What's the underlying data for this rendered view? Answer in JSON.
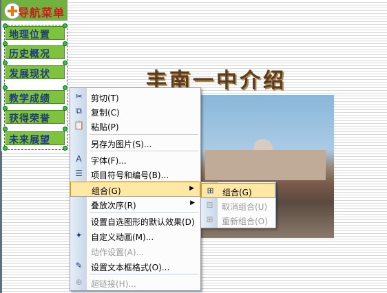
{
  "slide": {
    "heading": "丰南一中介绍",
    "nav": {
      "title": "导航菜单",
      "buttons": [
        "地理位置",
        "历史概况",
        "发展现状",
        "教学成绩",
        "获得荣誉",
        "未来展望"
      ]
    }
  },
  "context_menu": {
    "items": [
      {
        "label": "剪切(T)",
        "icon": "cut-icon",
        "glyph": "✂",
        "disabled": false
      },
      {
        "label": "复制(C)",
        "icon": "copy-icon",
        "glyph": "⧉",
        "disabled": false
      },
      {
        "label": "粘贴(P)",
        "icon": "paste-icon",
        "glyph": "📋",
        "disabled": false
      },
      {
        "label": "另存为图片(S)...",
        "icon": "",
        "glyph": "",
        "disabled": false
      },
      {
        "label": "字体(F)...",
        "icon": "font-icon",
        "glyph": "A",
        "disabled": false
      },
      {
        "label": "项目符号和编号(B)...",
        "icon": "bullets-icon",
        "glyph": "☰",
        "disabled": false
      },
      {
        "label": "组合(G)",
        "icon": "",
        "glyph": "",
        "disabled": false,
        "submenu": true,
        "highlighted": true
      },
      {
        "label": "叠放次序(R)",
        "icon": "",
        "glyph": "",
        "disabled": false,
        "submenu": true
      },
      {
        "label": "设置自选图形的默认效果(D)",
        "icon": "",
        "glyph": "",
        "disabled": false
      },
      {
        "label": "自定义动画(M)...",
        "icon": "animation-icon",
        "glyph": "✦",
        "disabled": false
      },
      {
        "label": "动作设置(A)...",
        "icon": "",
        "glyph": "",
        "disabled": true
      },
      {
        "label": "设置文本框格式(O)...",
        "icon": "format-icon",
        "glyph": "✎",
        "disabled": false
      },
      {
        "label": "超链接(H)...",
        "icon": "hyperlink-icon",
        "glyph": "⊕",
        "disabled": true
      }
    ]
  },
  "group_submenu": {
    "items": [
      {
        "label": "组合(G)",
        "icon": "group-icon",
        "glyph": "⊞",
        "disabled": false,
        "highlighted": true
      },
      {
        "label": "取消组合(U)",
        "icon": "ungroup-icon",
        "glyph": "⊟",
        "disabled": true
      },
      {
        "label": "重新组合(O)",
        "icon": "regroup-icon",
        "glyph": "⊞",
        "disabled": true
      }
    ]
  },
  "colors": {
    "highlight": "#ffe7a6",
    "nav_button": "#7fc23f",
    "nav_text": "#1e3c78",
    "nav_title": "#d21919"
  }
}
